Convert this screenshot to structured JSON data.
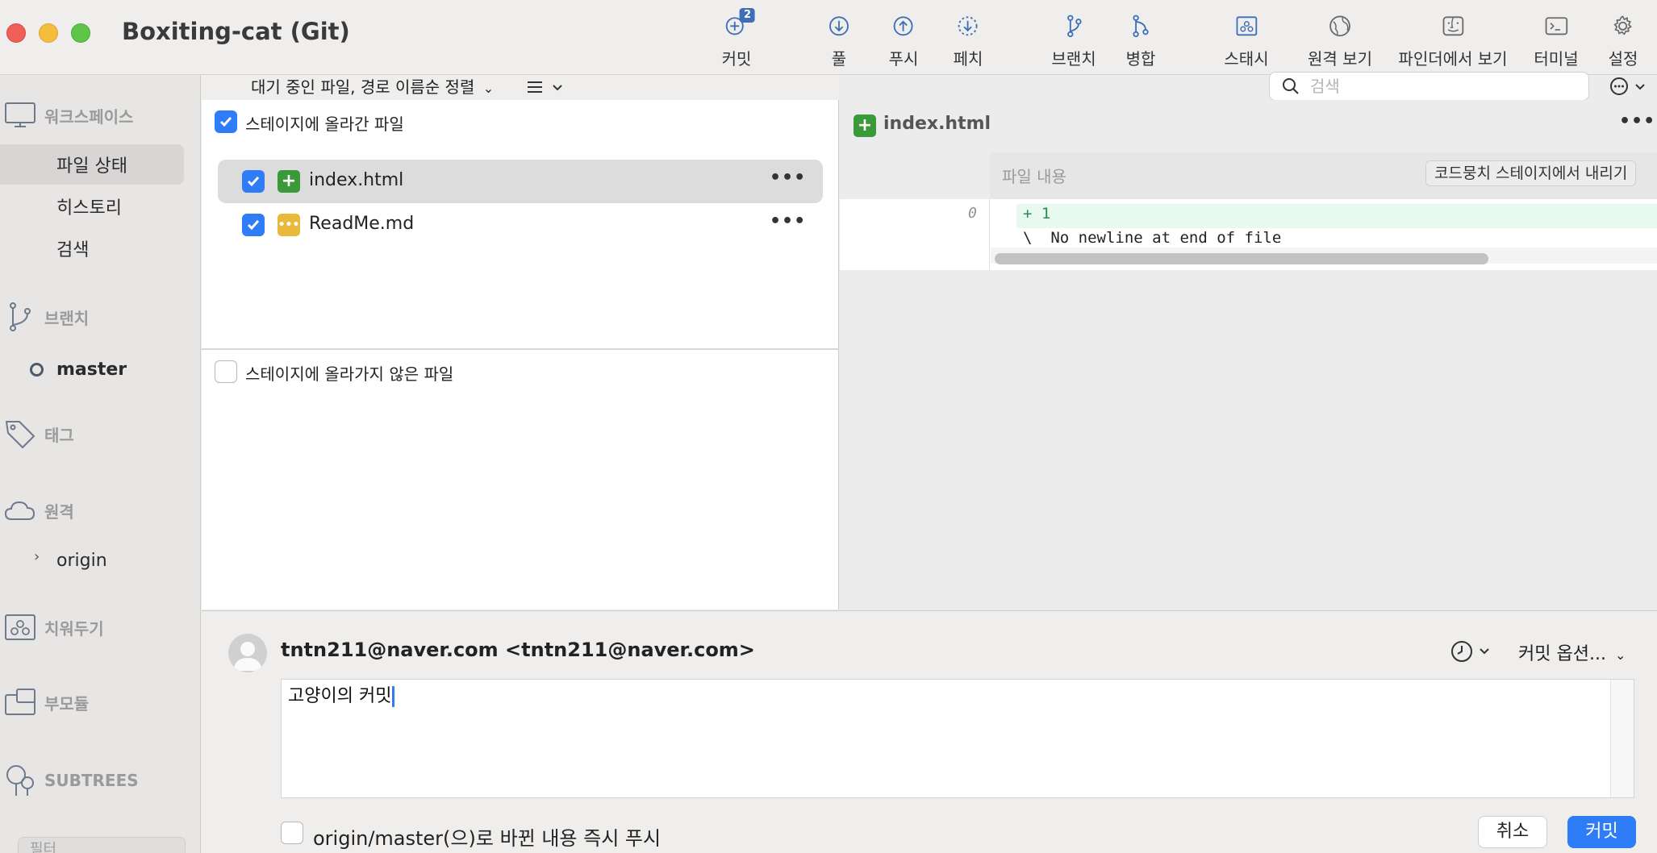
{
  "window": {
    "title": "Boxiting-cat (Git)"
  },
  "toolbar": {
    "commit": {
      "label": "커밋",
      "badge": "2"
    },
    "pull": "풀",
    "push": "푸시",
    "fetch": "페치",
    "branch": "브랜치",
    "merge": "병합",
    "stash": "스태시",
    "remote": "원격 보기",
    "finder": "파인더에서 보기",
    "terminal": "터미널",
    "settings": "설정"
  },
  "sidebar": {
    "workspace": "워크스페이스",
    "file_status": "파일 상태",
    "history": "히스토리",
    "search": "검색",
    "branches": "브랜치",
    "branch_master": "master",
    "tags": "태그",
    "remotes": "원격",
    "remote_origin": "origin",
    "stashes": "치워두기",
    "submodules": "부모듈",
    "subtrees": "SUBTREES",
    "filter_placeholder": "필터"
  },
  "files": {
    "sort_label": "대기 중인 파일, 경로 이름순 정렬",
    "staged_title": "스테이지에 올라간 파일",
    "unstaged_title": "스테이지에 올라가지 않은 파일",
    "staged": [
      {
        "name": "index.html",
        "status": "added"
      },
      {
        "name": "ReadMe.md",
        "status": "modified"
      }
    ]
  },
  "search": {
    "placeholder": "검색"
  },
  "diff": {
    "filename": "index.html",
    "hunk_title": "파일 내용",
    "unstage_hunk": "코드뭉치 스테이지에서 내리기",
    "line_number": "0",
    "line1": "+ 1",
    "line2": "\\  No newline at end of file"
  },
  "commit": {
    "author": "tntn211@naver.com <tntn211@naver.com>",
    "options": "커밋 옵션...",
    "message": "고양이의 커밋",
    "push_label": "origin/master(으)로 바뀐 내용 즉시 푸시",
    "cancel": "취소",
    "submit": "커밋"
  },
  "colors": {
    "accent": "#2e7cf6",
    "added": "#3a9a3a",
    "modified": "#e9b93c",
    "icon_blue": "#3d6fb6"
  }
}
